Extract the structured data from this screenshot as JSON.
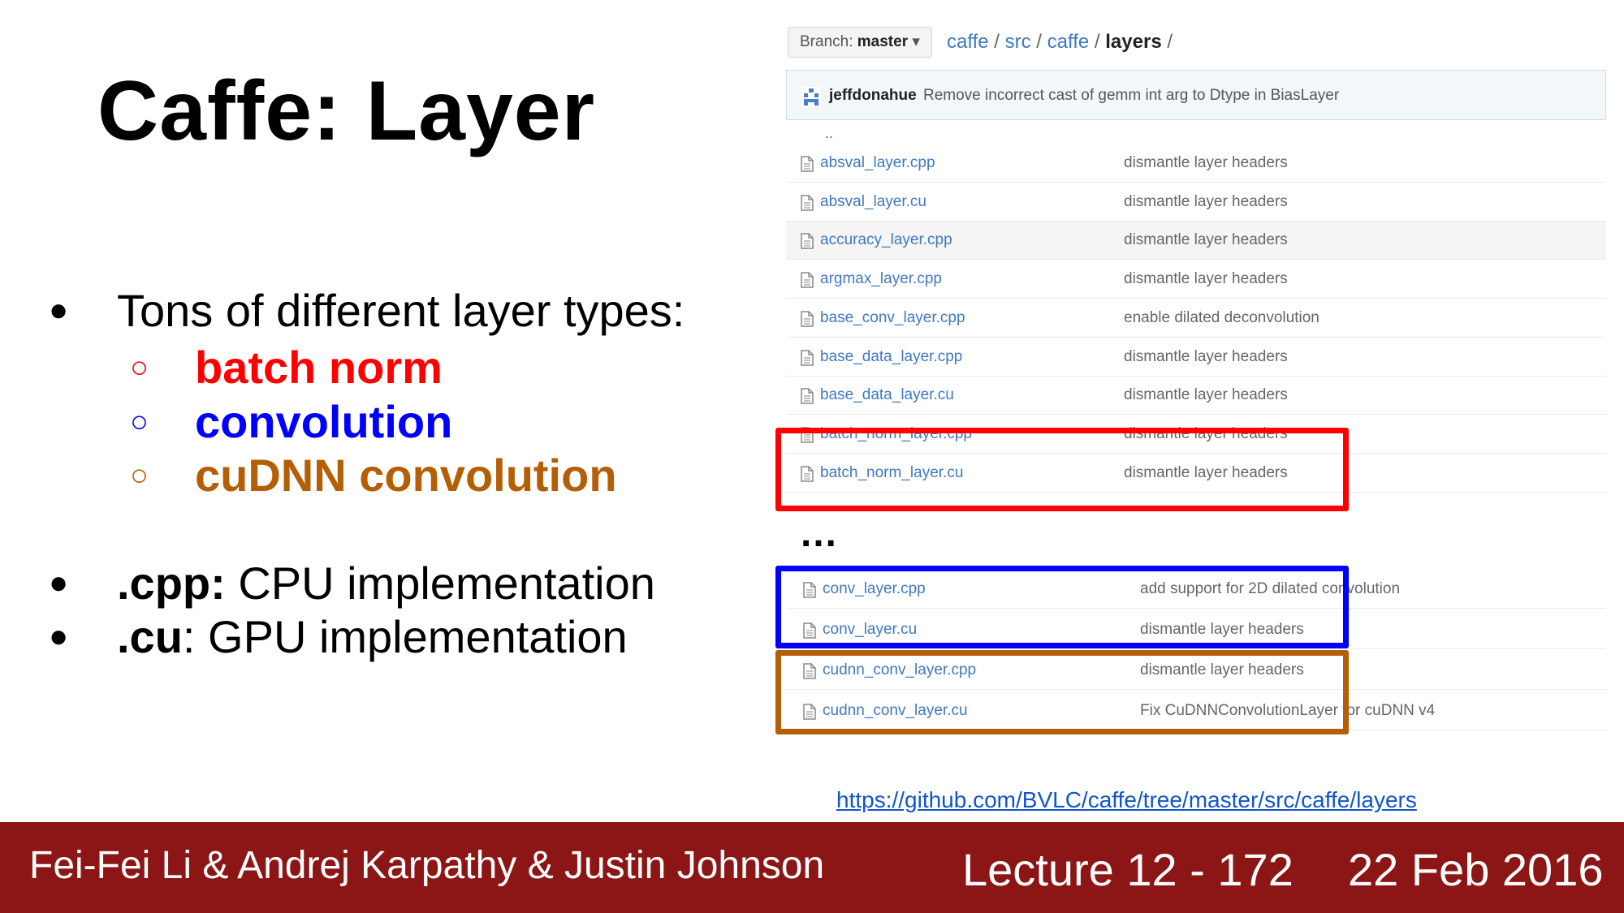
{
  "slide": {
    "title": "Caffe: Layer",
    "bullets": [
      {
        "dot": "●",
        "text": "Tons of different layer types:"
      },
      {
        "dot": "●",
        "bold": ".cpp:",
        "text": " CPU implementation"
      },
      {
        "dot": "●",
        "bold": ".cu",
        "text": ": GPU implementation"
      }
    ],
    "sub_items": [
      {
        "marker": "○",
        "text": "batch norm",
        "color": "#ff0000"
      },
      {
        "marker": "○",
        "text": "convolution",
        "color": "#0000ff"
      },
      {
        "marker": "○",
        "text": "cuDNN convolution",
        "color": "#b45f06"
      }
    ],
    "ellipsis": "…",
    "link": "https://github.com/BVLC/caffe/tree/master/src/caffe/layers"
  },
  "github": {
    "branch_label": "Branch:",
    "branch_value": "master",
    "branch_caret": "▾",
    "breadcrumb": [
      "caffe",
      "src",
      "caffe",
      "layers"
    ],
    "separator": "/",
    "commit_author": "jeffdonahue",
    "commit_message": "Remove incorrect cast of gemm int arg to Dtype in BiasLayer",
    "parent_dir": "..",
    "files": [
      {
        "name": "absval_layer.cpp",
        "message": "dismantle layer headers"
      },
      {
        "name": "absval_layer.cu",
        "message": "dismantle layer headers"
      },
      {
        "name": "accuracy_layer.cpp",
        "message": "dismantle layer headers"
      },
      {
        "name": "argmax_layer.cpp",
        "message": "dismantle layer headers"
      },
      {
        "name": "base_conv_layer.cpp",
        "message": "enable dilated deconvolution"
      },
      {
        "name": "base_data_layer.cpp",
        "message": "dismantle layer headers"
      },
      {
        "name": "base_data_layer.cu",
        "message": "dismantle layer headers"
      },
      {
        "name": "batch_norm_layer.cpp",
        "message": "dismantle layer headers"
      },
      {
        "name": "batch_norm_layer.cu",
        "message": "dismantle layer headers"
      }
    ],
    "files_after": [
      {
        "name": "conv_layer.cpp",
        "message": "add support for 2D dilated convolution"
      },
      {
        "name": "conv_layer.cu",
        "message": "dismantle layer headers"
      },
      {
        "name": "cudnn_conv_layer.cpp",
        "message": "dismantle layer headers"
      },
      {
        "name": "cudnn_conv_layer.cu",
        "message": "Fix CuDNNConvolutionLayer for cuDNN v4"
      }
    ],
    "highlight_colors": {
      "batch_norm": "#ff0000",
      "conv": "#0000ff",
      "cudnn": "#b45f06"
    }
  },
  "footer": {
    "authors": "Fei-Fei Li & Andrej Karpathy & Justin Johnson",
    "lecture": "Lecture 12 - 172",
    "date": "22 Feb 2016",
    "background": "#8c1515"
  }
}
